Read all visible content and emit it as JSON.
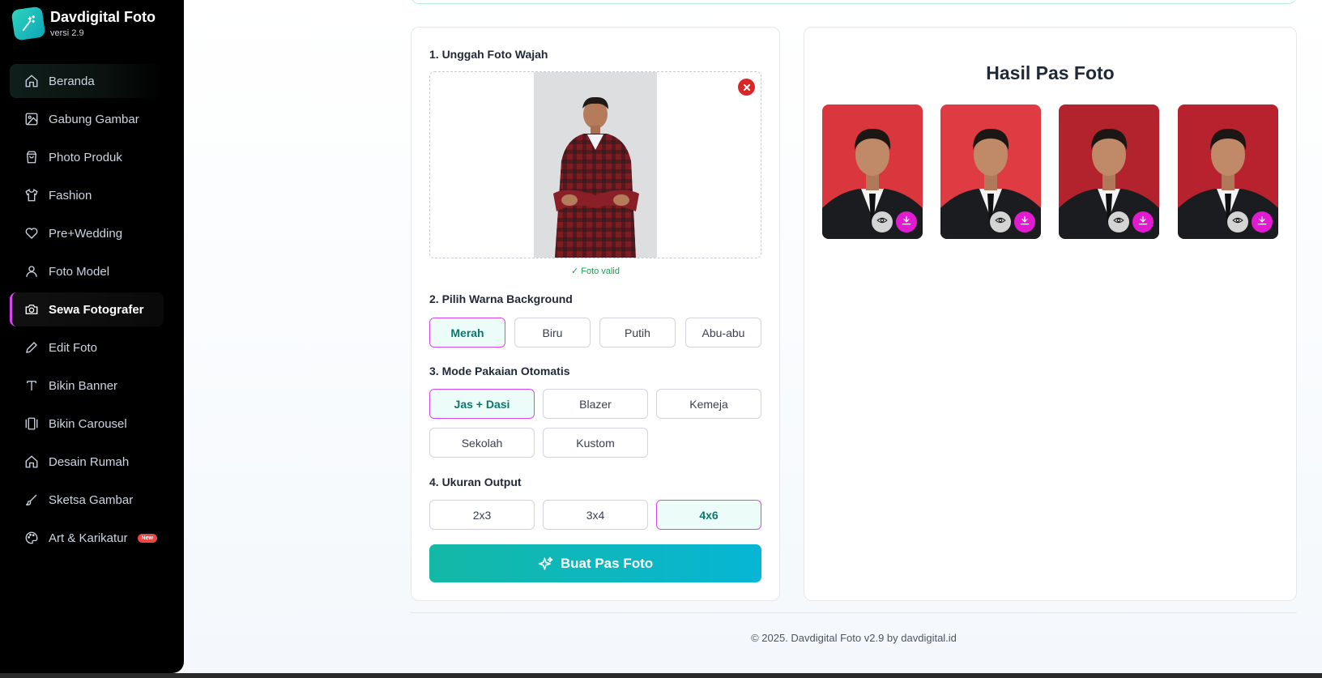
{
  "brand": {
    "title": "Davdigital Foto",
    "version": "versi 2.9"
  },
  "sidebar": {
    "items": [
      {
        "label": "Beranda",
        "icon": "home-icon"
      },
      {
        "label": "Gabung Gambar",
        "icon": "image-icon"
      },
      {
        "label": "Photo Produk",
        "icon": "shopping-bag-icon"
      },
      {
        "label": "Fashion",
        "icon": "shirt-icon"
      },
      {
        "label": "Pre+Wedding",
        "icon": "heart-icon"
      },
      {
        "label": "Foto Model",
        "icon": "user-icon"
      },
      {
        "label": "Sewa Fotografer",
        "icon": "camera-icon"
      },
      {
        "label": "Edit Foto",
        "icon": "pencil-icon"
      },
      {
        "label": "Bikin Banner",
        "icon": "text-icon"
      },
      {
        "label": "Bikin Carousel",
        "icon": "carousel-icon"
      },
      {
        "label": "Desain Rumah",
        "icon": "house-icon"
      },
      {
        "label": "Sketsa Gambar",
        "icon": "brush-icon"
      },
      {
        "label": "Art & Karikatur",
        "icon": "palette-icon",
        "badge": "New"
      }
    ],
    "active": "Sewa Fotografer"
  },
  "form": {
    "step1_label": "1. Unggah Foto Wajah",
    "valid_text": "✓ Foto valid",
    "step2_label": "2. Pilih Warna Background",
    "backgrounds": [
      "Merah",
      "Biru",
      "Putih",
      "Abu-abu"
    ],
    "background_selected": "Merah",
    "step3_label": "3. Mode Pakaian Otomatis",
    "clothing": [
      "Jas + Dasi",
      "Blazer",
      "Kemeja",
      "Sekolah",
      "Kustom"
    ],
    "clothing_selected": "Jas + Dasi",
    "step4_label": "4. Ukuran Output",
    "sizes": [
      "2x3",
      "3x4",
      "4x6"
    ],
    "size_selected": "4x6",
    "generate_label": "Buat Pas Foto"
  },
  "results": {
    "title": "Hasil Pas Foto",
    "items": [
      {
        "bg_color": "#d9363e"
      },
      {
        "bg_color": "#de3b43"
      },
      {
        "bg_color": "#b3232d"
      },
      {
        "bg_color": "#b8222e"
      }
    ]
  },
  "colors": {
    "accent_teal": "#14b8a6",
    "accent_magenta": "#d946ef",
    "danger": "#dc2626"
  },
  "footer": {
    "text": "© 2025. Davdigital Foto v2.9 by davdigital.id"
  }
}
